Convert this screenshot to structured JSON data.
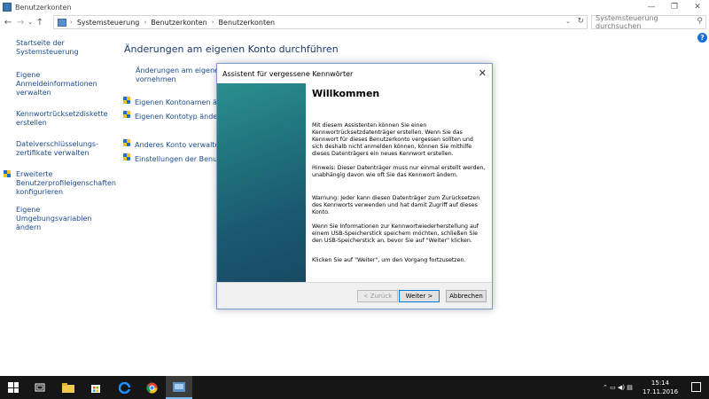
{
  "window": {
    "title": "Benutzerkonten",
    "minimize": "—",
    "maximize": "❐",
    "close": "✕"
  },
  "nav": {
    "back": "←",
    "forward": "→",
    "history": "⌄",
    "up": "↑",
    "breadcrumbs": [
      "Systemsteuerung",
      "Benutzerkonten",
      "Benutzerkonten"
    ],
    "separator": "›",
    "dropdown": "⌄",
    "refresh": "↻",
    "search_placeholder": "Systemsteuerung durchsuchen",
    "search_icon": "⚲",
    "help": "?"
  },
  "sidebar": {
    "items": [
      "Startseite der Systemsteuerung",
      "Eigene Anmeldeinformationen verwalten",
      "Kennwortrücksetzdiskette erstellen",
      "Dateiverschlüsselungs-zertifikate verwalten",
      "Erweiterte Benutzerprofileigenschaften konfigurieren",
      "Eigene Umgebungsvariablen ändern"
    ]
  },
  "main": {
    "title": "Änderungen am eigenen Konto durchführen",
    "links": [
      "Änderungen am eigenen Ko",
      "vornehmen",
      "Eigenen Kontonamen änder",
      "Eigenen Kontotyp ändern",
      "Anderes Konto verwalten",
      "Einstellungen der Benutzerko"
    ]
  },
  "dialog": {
    "title": "Assistent für vergessene Kennwörter",
    "close": "✕",
    "heading": "Willkommen",
    "paragraphs": [
      "Mit diesem Assistenten können Sie einen Kennwortrücksetzdatenträger erstellen. Wenn Sie das Kennwort für dieses Benutzerkonto vergessen sollten und sich deshalb nicht anmelden können, können Sie mithilfe dieses Datenträgers ein neues Kennwort erstellen.",
      "Hinweis: Dieser Datenträger muss nur einmal erstellt werden, unabhängig davon wie oft Sie das Kennwort ändern.",
      "Warnung: Jeder kann diesen Datenträger zum Zurücksetzen des Kennworts verwenden und hat damit Zugriff auf dieses Konto.",
      "Wenn Sie Informationen zur Kennwortwiederherstellung auf einem USB-Speicherstick speichern möchten, schließen Sie den USB-Speicherstick an, bevor Sie auf \"Weiter\" klicken.",
      "Klicken Sie auf \"Weiter\", um den Vorgang fortzusetzen."
    ],
    "buttons": {
      "back": "< Zurück",
      "next": "Weiter >",
      "cancel": "Abbrechen"
    }
  },
  "taskbar": {
    "tray_icons": "⌃ ▭ ◀) ▤",
    "time": "15:14",
    "date": "17.11.2016"
  },
  "colors": {
    "link": "#1b4a8a",
    "banner_top": "#2b8f8f",
    "banner_bottom": "#174a63",
    "taskbar": "#161616"
  }
}
